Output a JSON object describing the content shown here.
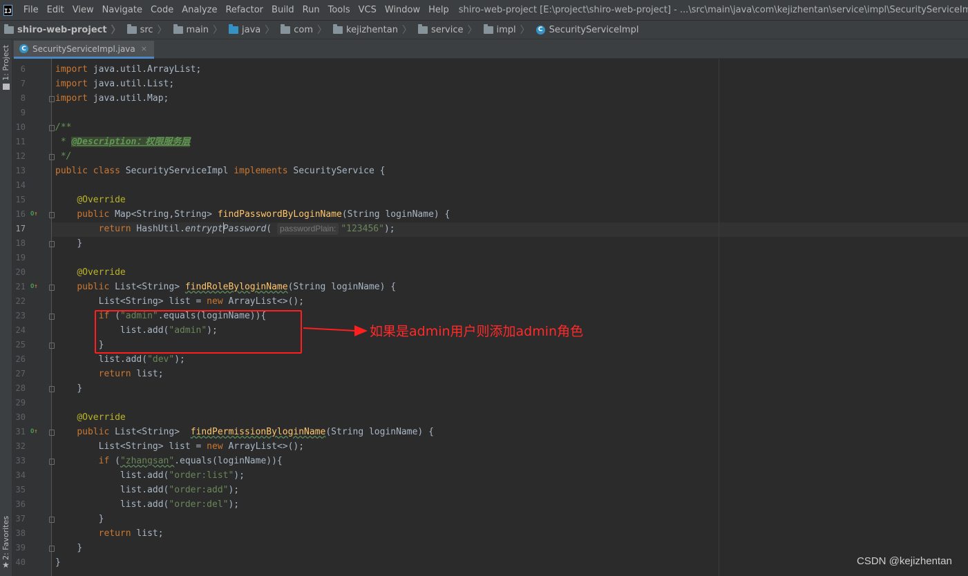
{
  "menubar": {
    "items": [
      "File",
      "Edit",
      "View",
      "Navigate",
      "Code",
      "Analyze",
      "Refactor",
      "Build",
      "Run",
      "Tools",
      "VCS",
      "Window",
      "Help"
    ],
    "window_title": "shiro-web-project [E:\\project\\shiro-web-project] - ...\\src\\main\\java\\com\\kejizhentan\\service\\impl\\SecurityServiceImpl.java - IntelliJ IDEA"
  },
  "breadcrumb": [
    "shiro-web-project",
    "src",
    "main",
    "java",
    "com",
    "kejizhentan",
    "service",
    "impl",
    "SecurityServiceImpl"
  ],
  "toolstrip": {
    "project": "1: Project",
    "favorites": "2: Favorites"
  },
  "tab": {
    "label": "SecurityServiceImpl.java",
    "close": "×"
  },
  "editor": {
    "line_numbers": [
      "6",
      "7",
      "8",
      "9",
      "10",
      "11",
      "12",
      "13",
      "14",
      "15",
      "16",
      "17",
      "18",
      "19",
      "20",
      "21",
      "22",
      "23",
      "24",
      "25",
      "26",
      "27",
      "28",
      "29",
      "30",
      "31",
      "32",
      "33",
      "34",
      "35",
      "36",
      "37",
      "38",
      "39",
      "40"
    ],
    "current_line": "17",
    "lines": {
      "l6": [
        "import",
        " java.util.ArrayList;"
      ],
      "l7": [
        "import",
        " java.util.List;"
      ],
      "l8": [
        "import",
        " java.util.Map;"
      ],
      "l10": "/**",
      "l11": [
        " * ",
        "@Description：权限服务层"
      ],
      "l12": " */",
      "l13": [
        "public class",
        " SecurityServiceImpl ",
        "implements",
        " SecurityService {"
      ],
      "l15": "@Override",
      "l16": [
        "public",
        " Map<String,String> ",
        "findPasswordByLoginName",
        "(String loginName) {"
      ],
      "l17": [
        "return",
        " HashUtil.",
        "entrypt",
        "Password",
        "(",
        "passwordPlain:",
        "\"123456\"",
        ");"
      ],
      "l18": "}",
      "l20": "@Override",
      "l21": [
        "public",
        " List<String> ",
        "findRoleByloginName",
        "(String loginName) {"
      ],
      "l22": [
        "List<String> list = ",
        "new",
        " ArrayList<>();"
      ],
      "l23": [
        "if",
        " (",
        "\"admin\"",
        ".equals(loginName)){"
      ],
      "l24": [
        "list.add(",
        "\"admin\"",
        ");"
      ],
      "l25": "}",
      "l26": [
        "list.add(",
        "\"dev\"",
        ");"
      ],
      "l27": [
        "return",
        " list;"
      ],
      "l28": "}",
      "l30": "@Override",
      "l31": [
        "public",
        " List<String>  ",
        "findPermissionByloginName",
        "(String loginName) {"
      ],
      "l32": [
        "List<String> list = ",
        "new",
        " ArrayList<>();"
      ],
      "l33": [
        "if",
        " (",
        "\"zhangsan\"",
        ".equals(loginName)){"
      ],
      "l34": [
        "list.add(",
        "\"order:list\"",
        ");"
      ],
      "l35": [
        "list.add(",
        "\"order:add\"",
        ");"
      ],
      "l36": [
        "list.add(",
        "\"order:del\"",
        ");"
      ],
      "l37": "}",
      "l38": [
        "return",
        " list;"
      ],
      "l39": "}",
      "l40": "}"
    }
  },
  "annotation": {
    "note": "如果是admin用户则添加admin角色",
    "color": "#ff2a2a"
  },
  "watermark": "CSDN @kejizhentan",
  "colors": {
    "keyword": "#cc7832",
    "string": "#6a8759",
    "annotation": "#bbb529",
    "method": "#ffc66d",
    "text": "#a9b7c6",
    "background": "#2b2b2b"
  }
}
